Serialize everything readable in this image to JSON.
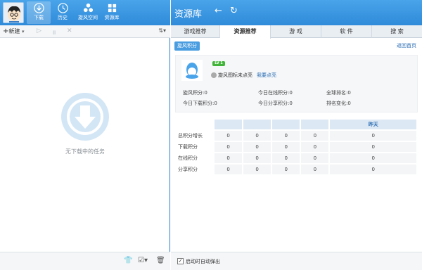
{
  "left": {
    "nav": [
      {
        "label": "下载",
        "icon": "download-icon"
      },
      {
        "label": "历史",
        "icon": "history-icon"
      },
      {
        "label": "旋风空间",
        "icon": "cloud-space-icon"
      },
      {
        "label": "资源库",
        "icon": "library-icon"
      }
    ],
    "toolbar": {
      "new_label": "新建",
      "new_plus": "+",
      "dropdown": "▾",
      "play": "▷",
      "pause": "॥",
      "delete": "✕",
      "sort": "⇅▾"
    },
    "empty_text": "无下载中的任务",
    "bottom": {
      "tshirt": "👕",
      "check": "☑▾",
      "trash": "🗑"
    }
  },
  "right": {
    "title": "资源库",
    "back": "←",
    "refresh": "↻",
    "tabs": [
      "游戏推荐",
      "资源推荐",
      "游 戏",
      "软 件",
      "搜 索"
    ],
    "active_tab": 1,
    "sub_button": "旋风积分",
    "back_home": "返回首页",
    "level": "LV 1",
    "status_text": "旋风图标未点亮",
    "light_link": "我要点亮",
    "stats": {
      "xuanfeng_points": "旋风积分:0",
      "today_download_points": "今日下载积分:0",
      "today_online_points": "今日在线积分:0",
      "today_share_points": "今日分享积分:0",
      "global_rank": "全球排名:0",
      "rank_change": "排名变化:0"
    },
    "grid": {
      "header_last": "昨天",
      "rows": [
        {
          "label": "总积分增长",
          "values": [
            "0",
            "0",
            "0",
            "0",
            "0"
          ]
        },
        {
          "label": "下载积分",
          "values": [
            "0",
            "0",
            "0",
            "0",
            "0"
          ]
        },
        {
          "label": "在线积分",
          "values": [
            "0",
            "0",
            "0",
            "0",
            "0"
          ]
        },
        {
          "label": "分享积分",
          "values": [
            "0",
            "0",
            "0",
            "0",
            "0"
          ]
        }
      ]
    },
    "autostart_label": "启动时自动弹出",
    "autostart_check": "✓"
  },
  "colors": {
    "accent": "#3a96e4",
    "link": "#2a6cb3",
    "level_green": "#42b43a"
  }
}
